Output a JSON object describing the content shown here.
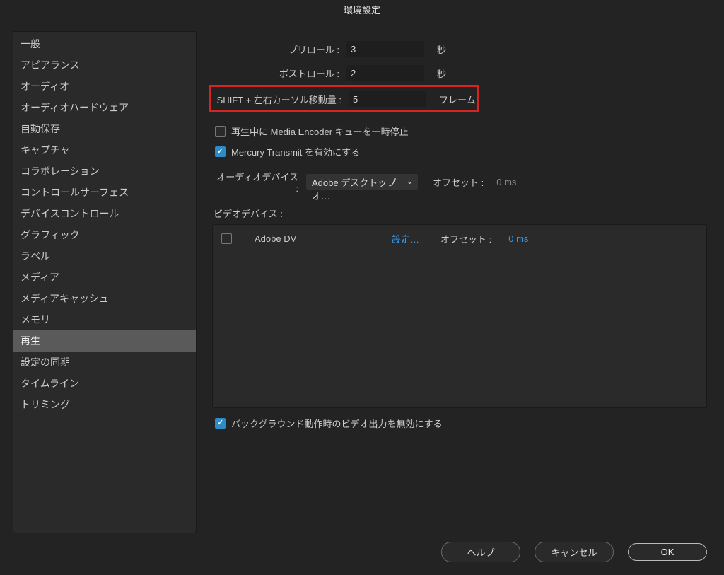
{
  "title": "環境設定",
  "sidebar": {
    "items": [
      "一般",
      "アピアランス",
      "オーディオ",
      "オーディオハードウェア",
      "自動保存",
      "キャプチャ",
      "コラボレーション",
      "コントロールサーフェス",
      "デバイスコントロール",
      "グラフィック",
      "ラベル",
      "メディア",
      "メディアキャッシュ",
      "メモリ",
      "再生",
      "設定の同期",
      "タイムライン",
      "トリミング"
    ],
    "selectedIndex": 14
  },
  "form": {
    "preroll": {
      "label": "プリロール :",
      "value": "3",
      "unit": "秒"
    },
    "postroll": {
      "label": "ポストロール :",
      "value": "2",
      "unit": "秒"
    },
    "shiftMove": {
      "label": "SHIFT + 左右カーソル移動量 :",
      "value": "5",
      "unit": "フレーム"
    },
    "pauseMeEncoder": {
      "checked": false,
      "label": "再生中に Media Encoder キューを一時停止"
    },
    "mercuryTransmit": {
      "checked": true,
      "label": "Mercury Transmit を有効にする"
    },
    "audioDevice": {
      "label": "オーディオデバイス :",
      "value": "Adobe デスクトップオ…",
      "offsetLabel": "オフセット :",
      "offsetValue": "0 ms"
    },
    "videoDeviceLabel": "ビデオデバイス :",
    "videoDevice": {
      "checked": false,
      "name": "Adobe DV",
      "settings": "設定…",
      "offsetLabel": "オフセット :",
      "offsetValue": "0 ms"
    },
    "disableBgOutput": {
      "checked": true,
      "label": "バックグラウンド動作時のビデオ出力を無効にする"
    }
  },
  "footer": {
    "help": "ヘルプ",
    "cancel": "キャンセル",
    "ok": "OK"
  }
}
